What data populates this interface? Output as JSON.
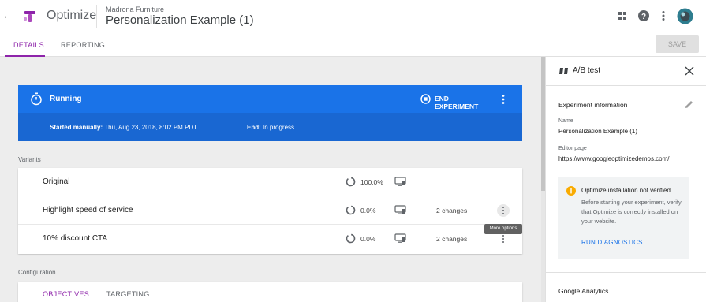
{
  "header": {
    "back_icon": "arrow-back-icon",
    "app_name": "Optimize",
    "container_name": "Madrona Furniture",
    "experiment_title": "Personalization Example (1)",
    "icons": [
      "apps-grid-icon",
      "help-icon",
      "more-vert-icon",
      "avatar"
    ]
  },
  "tabs": {
    "details": "DETAILS",
    "reporting": "REPORTING",
    "save": "SAVE"
  },
  "status": {
    "state": "Running",
    "end_button": "END EXPERIMENT",
    "started_label": "Started manually:",
    "started_value": "Thu, Aug 23, 2018, 8:02 PM PDT",
    "end_label": "End:",
    "end_value": "In progress"
  },
  "variants": {
    "section_label": "Variants",
    "rows": [
      {
        "name": "Original",
        "weight": "100.0%",
        "weight_fraction": 1.0,
        "changes": ""
      },
      {
        "name": "Highlight speed of service",
        "weight": "0.0%",
        "weight_fraction": 0.0,
        "changes": "2 changes"
      },
      {
        "name": "10% discount CTA",
        "weight": "0.0%",
        "weight_fraction": 0.0,
        "changes": "2 changes"
      }
    ],
    "tooltip": "More options"
  },
  "configuration": {
    "section_label": "Configuration",
    "tabs": [
      "OBJECTIVES",
      "TARGETING"
    ]
  },
  "panel": {
    "title": "A/B test",
    "info_heading": "Experiment information",
    "name_label": "Name",
    "name_value": "Personalization Example (1)",
    "editor_label": "Editor page",
    "editor_value": "https://www.googleoptimizedemos.com/",
    "warning_title": "Optimize installation not verified",
    "warning_body": "Before starting your experiment, verify that Optimize is correctly installed on your website.",
    "warning_action": "RUN DIAGNOSTICS",
    "analytics_heading": "Google Analytics"
  },
  "colors": {
    "accent_purple": "#8e24aa",
    "status_blue": "#1a73e8",
    "status_blue_dark": "#1967d2",
    "warning_yellow": "#f9ab00",
    "link_blue": "#1a73e8"
  }
}
